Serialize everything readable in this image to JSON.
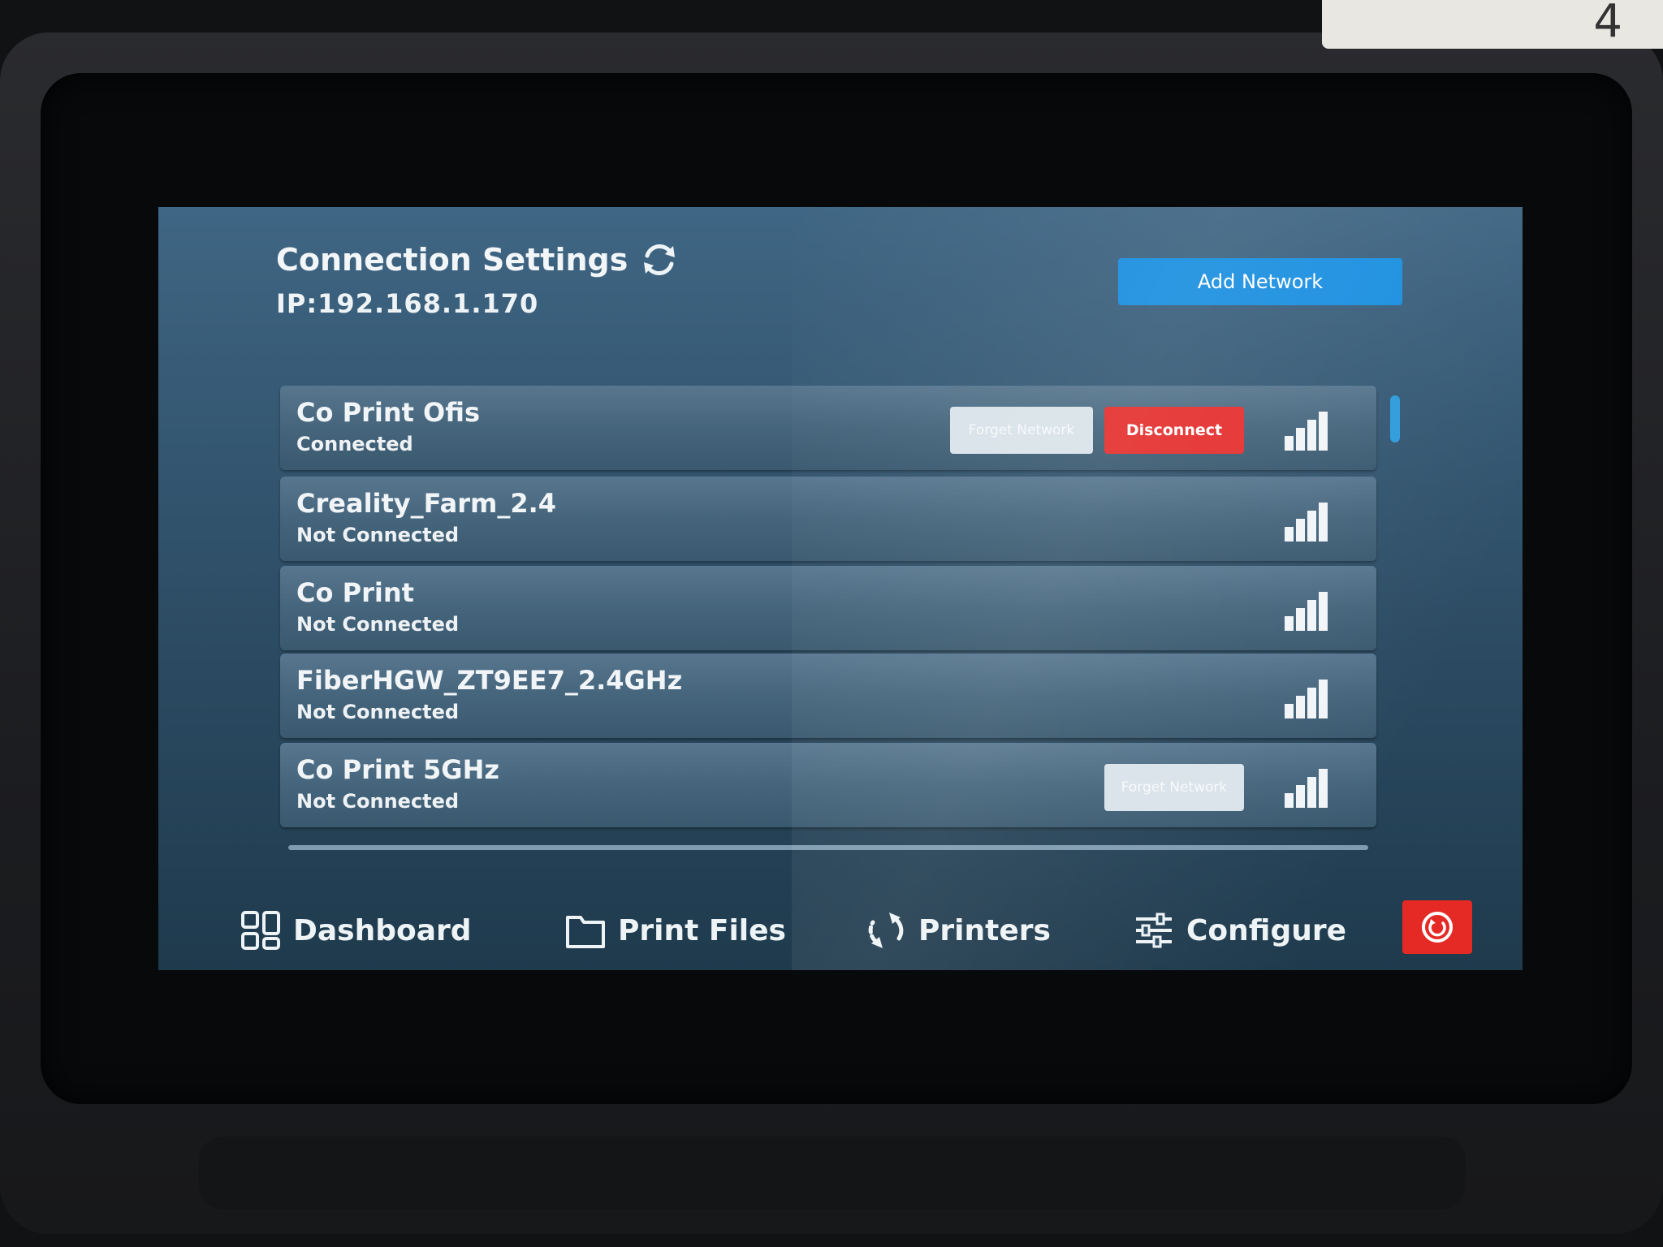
{
  "header": {
    "title": "Connection Settings",
    "ip": "IP:192.168.1.170",
    "add_network_label": "Add Network"
  },
  "networks": [
    {
      "name": "Co Print Ofis",
      "status": "Connected",
      "forget_label": "Forget Network",
      "disconnect_label": "Disconnect"
    },
    {
      "name": "Creality_Farm_2.4",
      "status": "Not Connected"
    },
    {
      "name": "Co Print",
      "status": "Not Connected"
    },
    {
      "name": "FiberHGW_ZT9EE7_2.4GHz",
      "status": "Not Connected"
    },
    {
      "name": "Co Print 5GHz",
      "status": "Not Connected",
      "forget_label": "Forget Network"
    }
  ],
  "nav": {
    "dashboard": "Dashboard",
    "print_files": "Print Files",
    "printers": "Printers",
    "configure": "Configure"
  },
  "sticker_text": "4",
  "colors": {
    "accent": "#1b8fe0",
    "danger": "#e4302f",
    "screen_bg": "#33556f"
  }
}
